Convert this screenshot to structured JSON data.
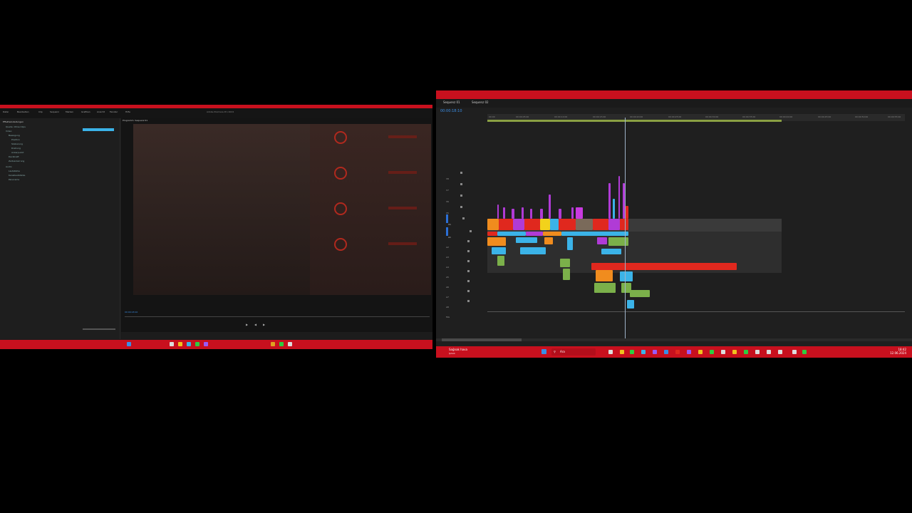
{
  "left_window": {
    "title": "Adobe Premiere Pro 2024",
    "menu_items": [
      "Datei",
      "Bearbeiten",
      "Clip",
      "Sequenz",
      "Marken",
      "Grafiken",
      "Ansicht",
      "Fenster",
      "Hilfe"
    ],
    "panel_title": "Effekteinstellungen",
    "panel_lines": [
      "Quelle: Ohne Clips",
      "Video",
      "Bewegung",
      "Position",
      "Skalierung",
      "Drehung",
      "Ankerpunkt",
      "Deckkraft",
      "Zeitverzerrung",
      "Audio",
      "Lautstärke",
      "Kanallautstärke",
      "Panorama"
    ],
    "monitor_title": "Programm: Sequenz 01",
    "timecode": "00:00:18:10"
  },
  "right_window": {
    "tabs": [
      "Sequenz 01",
      "Sequenz 02"
    ],
    "timecode": "00:00:18:10",
    "ruler_ticks": [
      "00:00",
      "00:00:05:00",
      "00:00:10:00",
      "00:00:15:00",
      "00:00:20:00",
      "00:00:25:00",
      "00:00:30:00",
      "00:00:35:00",
      "00:00:40:00",
      "00:00:45:00",
      "00:00:50:00",
      "00:00:55:00"
    ],
    "video_tracks": [
      "V8",
      "V7",
      "V6",
      "V5",
      "V4",
      "V3",
      "V2",
      "V1"
    ],
    "audio_tracks": [
      "A1",
      "A2",
      "A3",
      "A4",
      "A5",
      "A6",
      "A7",
      "A8",
      "Mix"
    ]
  },
  "taskbar": {
    "weather": "Sağnak hava",
    "weather_sub": "Şimdi",
    "search_placeholder": "Ara",
    "time": "18:42",
    "date": "12.06.2024"
  },
  "colors": {
    "accent": "#c8101e",
    "timecode": "#3a8ee6",
    "clip_cyan": "#3bb3e8",
    "clip_red": "#e0281e",
    "clip_yellow": "#f2d21b",
    "clip_magenta": "#b03bd6",
    "clip_green": "#7bb04a",
    "clip_orange": "#f08c1e"
  }
}
